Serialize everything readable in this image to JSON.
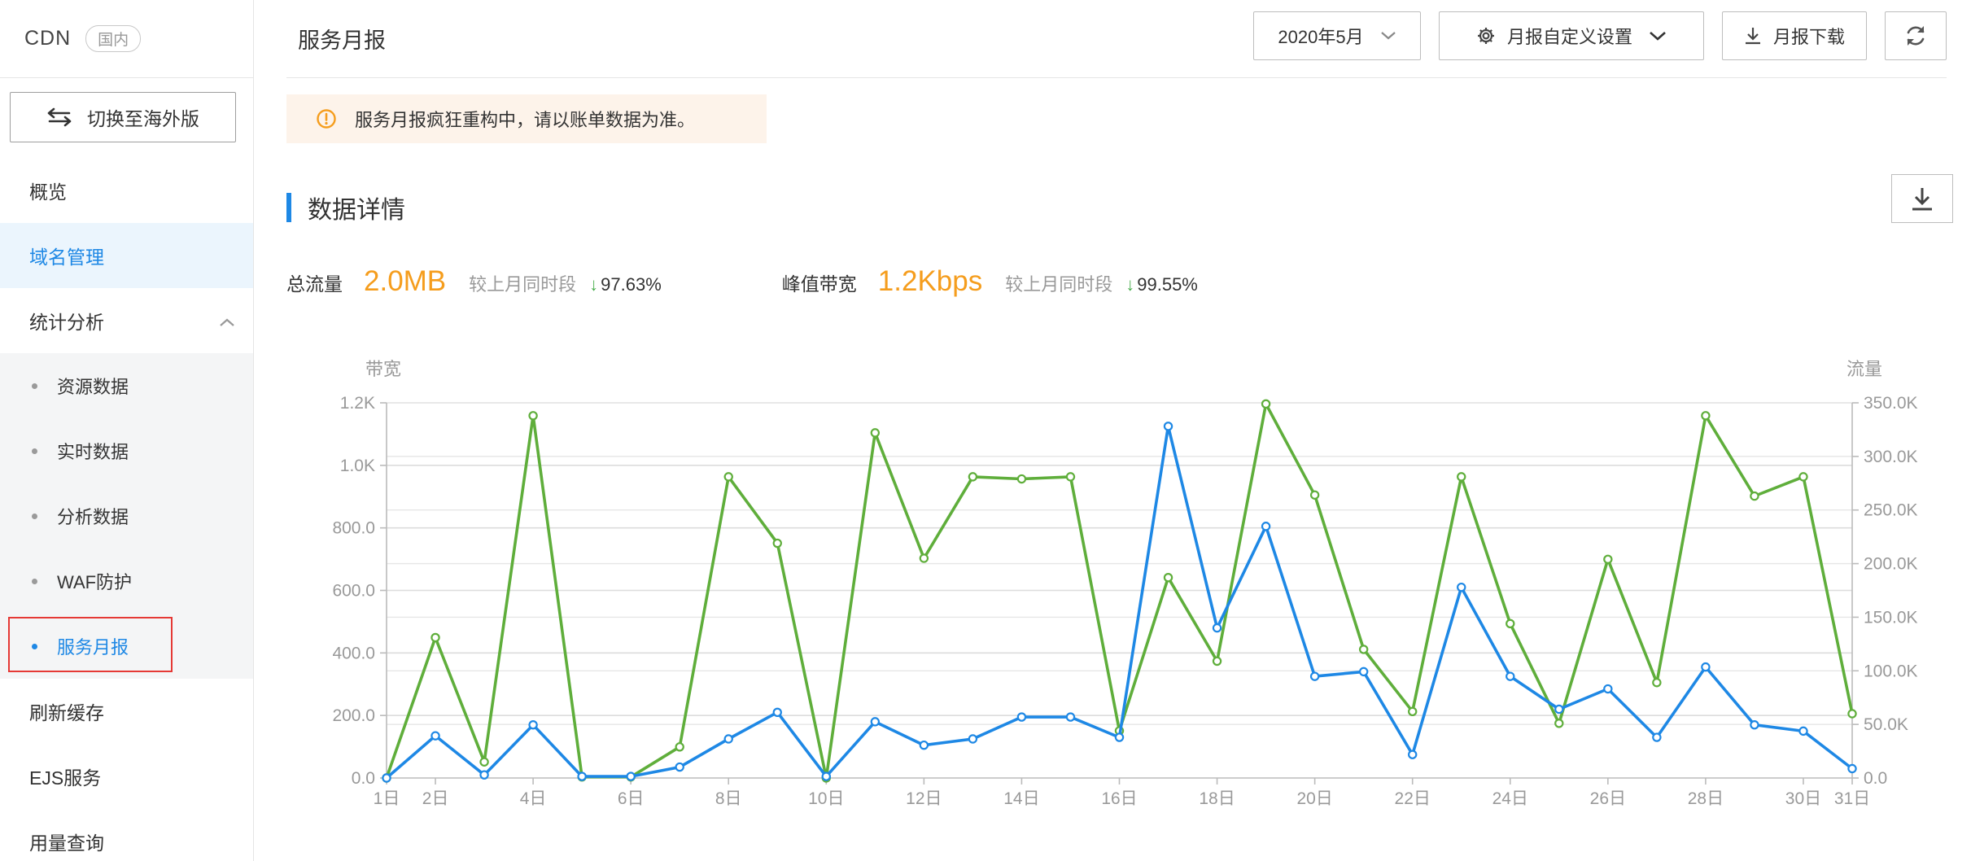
{
  "sidebar": {
    "brand": "CDN",
    "region": "国内",
    "switch_label": "切换至海外版",
    "items": [
      {
        "label": "概览"
      },
      {
        "label": "域名管理"
      },
      {
        "label": "统计分析"
      },
      {
        "label": "资源数据"
      },
      {
        "label": "实时数据"
      },
      {
        "label": "分析数据"
      },
      {
        "label": "WAF防护"
      },
      {
        "label": "服务月报"
      },
      {
        "label": "刷新缓存"
      },
      {
        "label": "EJS服务"
      },
      {
        "label": "用量查询"
      }
    ]
  },
  "header": {
    "title": "服务月报",
    "month_select": "2020年5月",
    "custom_settings": "月报自定义设置",
    "download": "月报下载"
  },
  "notice": {
    "text": "服务月报疯狂重构中，请以账单数据为准。"
  },
  "section": {
    "title": "数据详情"
  },
  "stats": {
    "total_traffic": {
      "label": "总流量",
      "value": "2.0MB",
      "compare": "较上月同时段",
      "change": "97.63%"
    },
    "peak_bandwidth": {
      "label": "峰值带宽",
      "value": "1.2Kbps",
      "compare": "较上月同时段",
      "change": "99.55%"
    }
  },
  "colors": {
    "accent": "#1e88e5",
    "value_orange": "#f59d1d",
    "down_green": "#4caf50",
    "bandwidth_series": "#1e88e5",
    "traffic_series": "#5fae3b",
    "highlight_border": "#e53935"
  },
  "icons": {
    "switch": "swap-arrows-icon",
    "settings": "gear-icon",
    "download": "download-icon",
    "refresh": "refresh-icon",
    "notice": "warning-circle-icon",
    "chevron": "chevron-down-icon",
    "collapse": "chevron-up-icon"
  },
  "chart_data": {
    "type": "line",
    "left_axis_label": "带宽",
    "right_axis_label": "流量",
    "x": [
      1,
      2,
      3,
      4,
      5,
      6,
      7,
      8,
      9,
      10,
      11,
      12,
      13,
      14,
      15,
      16,
      17,
      18,
      19,
      20,
      21,
      22,
      23,
      24,
      25,
      26,
      27,
      28,
      29,
      30,
      31
    ],
    "x_tick_labels": [
      "1日",
      "2日",
      "4日",
      "6日",
      "8日",
      "10日",
      "12日",
      "14日",
      "16日",
      "18日",
      "20日",
      "22日",
      "24日",
      "26日",
      "28日",
      "30日",
      "31日"
    ],
    "x_tick_days": [
      1,
      2,
      4,
      6,
      8,
      10,
      12,
      14,
      16,
      18,
      20,
      22,
      24,
      26,
      28,
      30,
      31
    ],
    "left_ticks": [
      "0.0",
      "200.0",
      "400.0",
      "600.0",
      "800.0",
      "1.0K",
      "1.2K"
    ],
    "right_ticks": [
      "0.0",
      "50.0K",
      "100.0K",
      "150.0K",
      "200.0K",
      "250.0K",
      "300.0K",
      "350.0K"
    ],
    "y_left_lim": [
      0,
      1200
    ],
    "y_right_lim": [
      0,
      350000
    ],
    "grid": true,
    "series": [
      {
        "axis": "left",
        "color": "#1e88e5",
        "values": [
          0,
          135,
          10,
          170,
          5,
          5,
          35,
          125,
          210,
          5,
          180,
          105,
          125,
          195,
          195,
          130,
          1125,
          480,
          805,
          325,
          340,
          75,
          610,
          325,
          220,
          285,
          130,
          355,
          170,
          150,
          30
        ]
      },
      {
        "axis": "right",
        "color": "#5fae3b",
        "values": [
          0,
          131000,
          15000,
          338000,
          1000,
          1000,
          29000,
          281000,
          219000,
          0,
          322000,
          205000,
          281000,
          279000,
          281000,
          44000,
          187000,
          109000,
          349000,
          264000,
          120000,
          62000,
          281000,
          144000,
          51000,
          204000,
          89000,
          338000,
          263000,
          281000,
          60000
        ]
      }
    ]
  }
}
